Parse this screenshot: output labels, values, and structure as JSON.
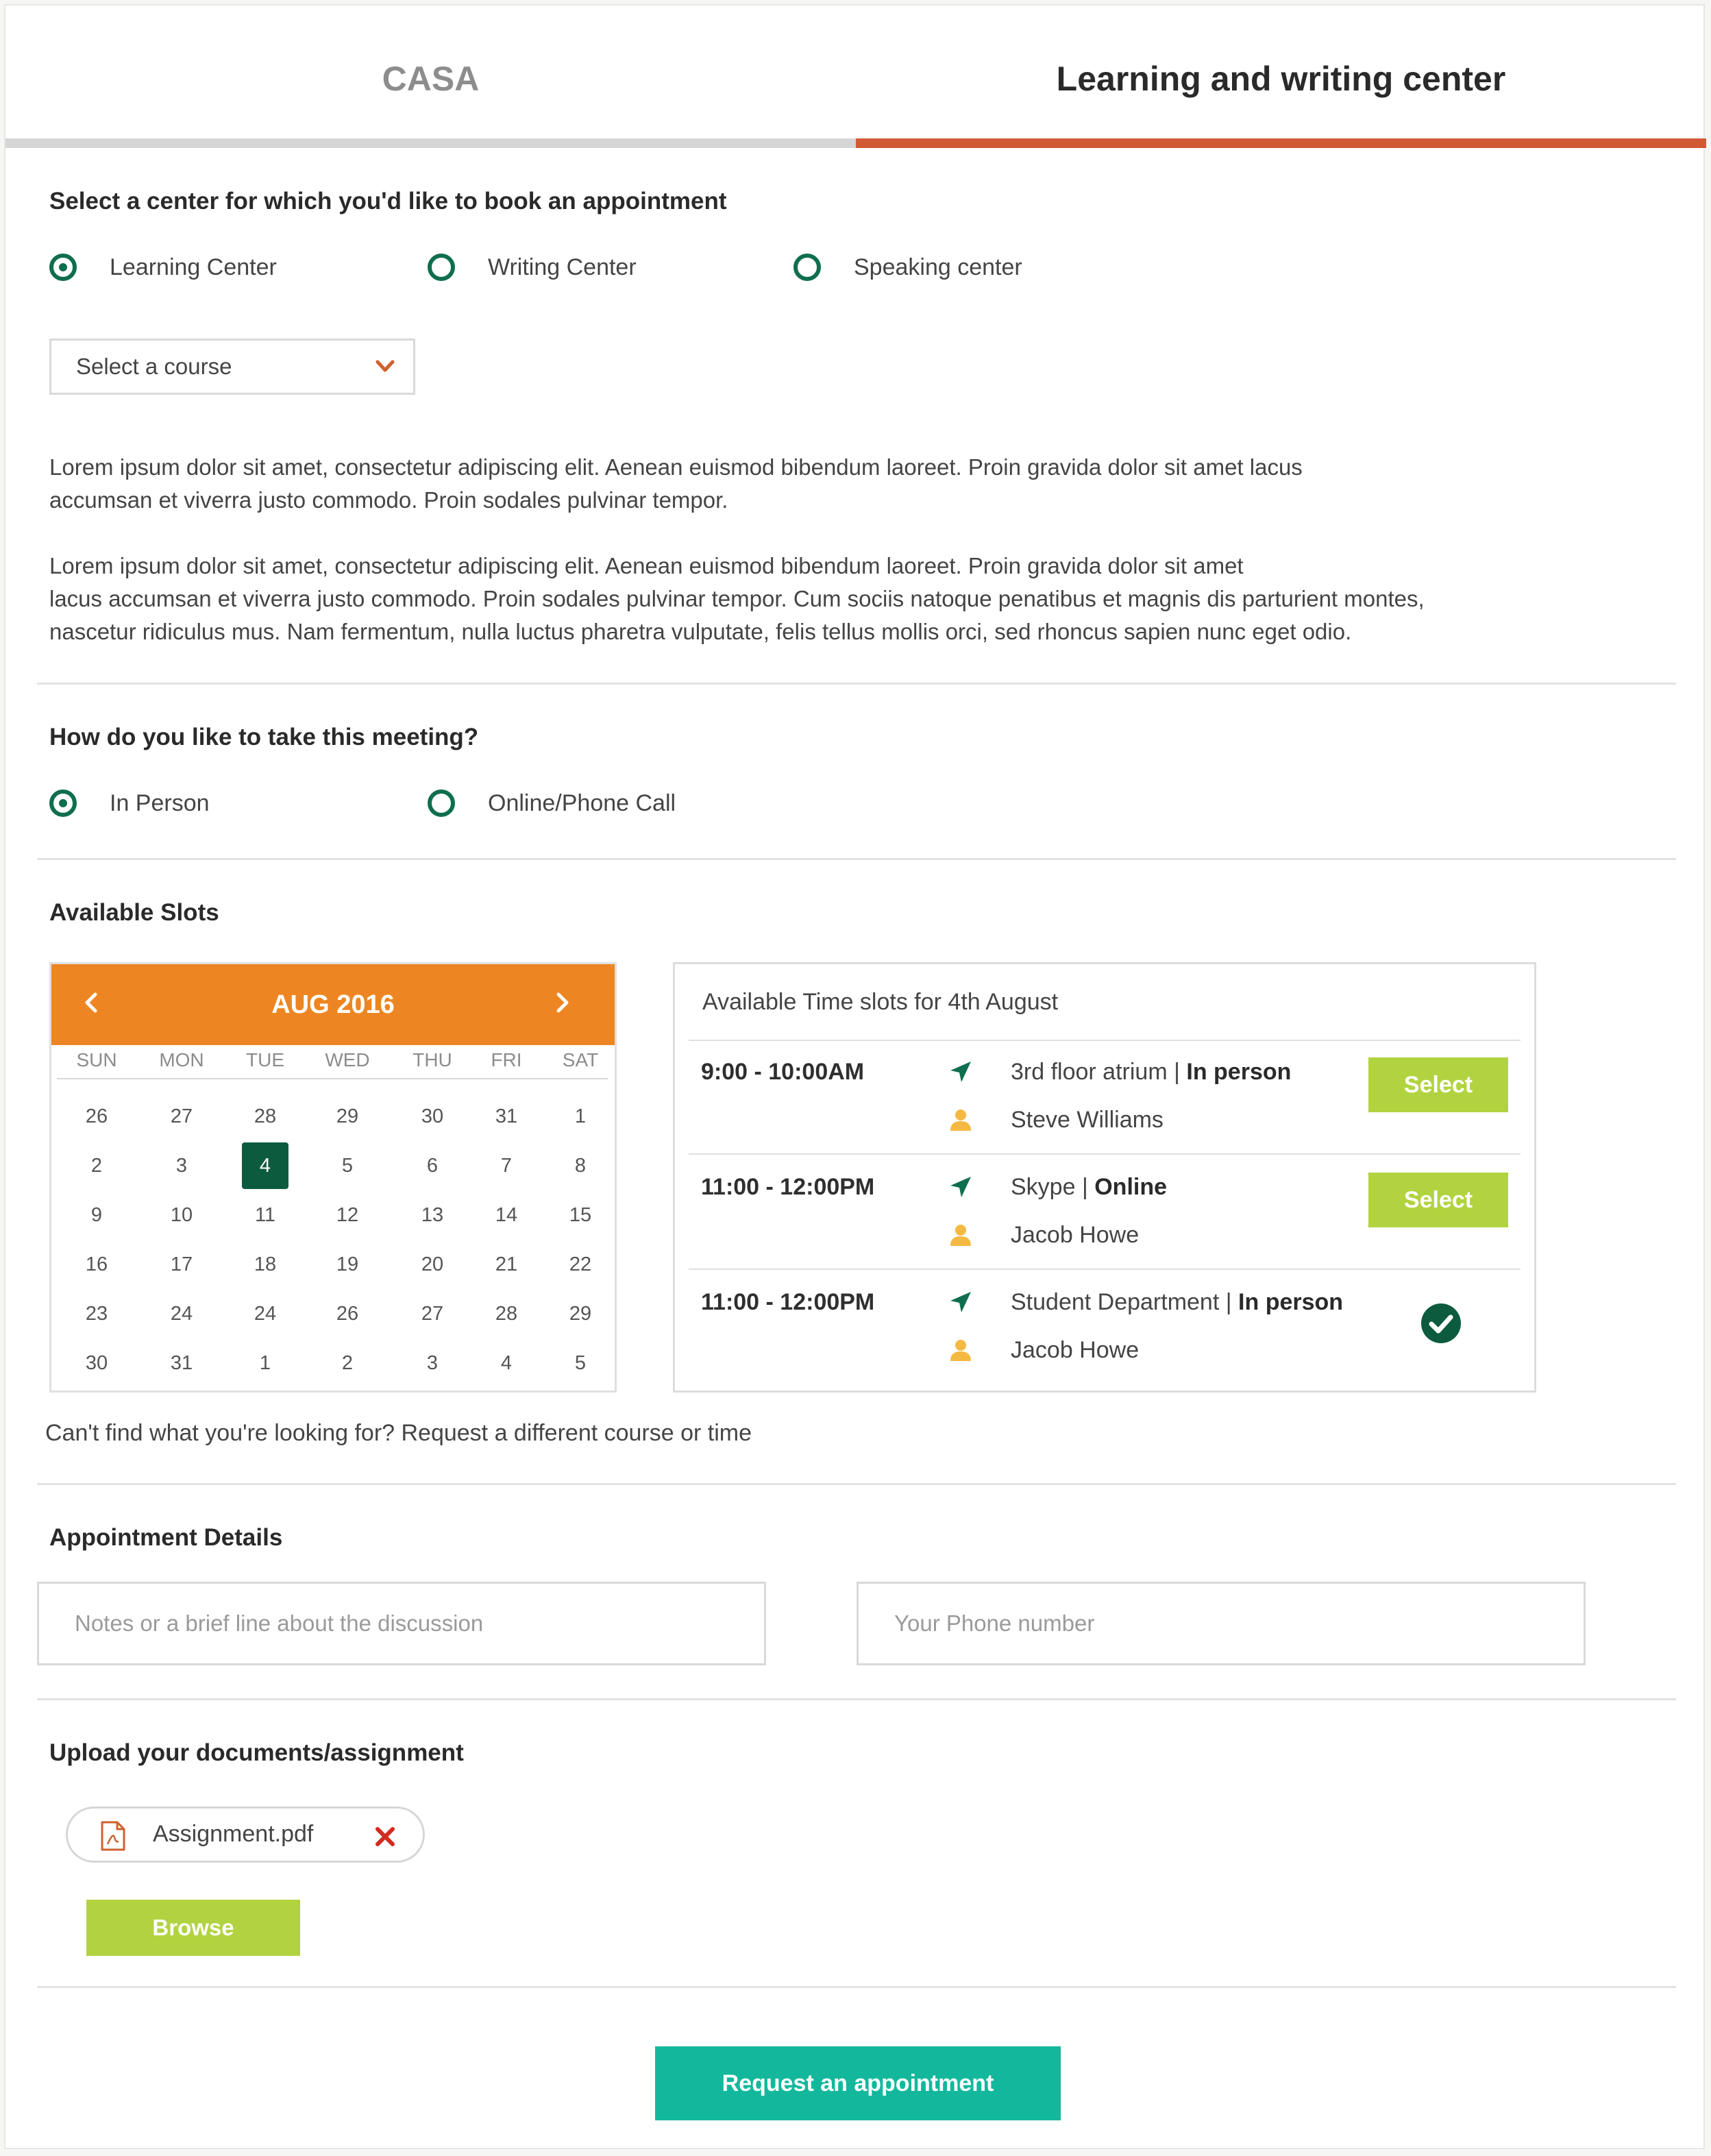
{
  "tabs": [
    {
      "label": "CASA",
      "active": false
    },
    {
      "label": "Learning and writing center",
      "active": true
    }
  ],
  "center_section": {
    "title": "Select a center for which you'd like to book an appointment",
    "options": [
      {
        "label": "Learning Center",
        "checked": true
      },
      {
        "label": "Writing Center",
        "checked": false
      },
      {
        "label": "Speaking center",
        "checked": false
      }
    ],
    "course_select": {
      "value": "Select a course",
      "icon": "chevron-down-icon"
    }
  },
  "description": {
    "p1": "Lorem ipsum dolor sit amet, consectetur adipiscing elit. Aenean euismod bibendum laoreet. Proin gravida dolor sit amet lacus accumsan et viverra justo commodo. Proin sodales pulvinar tempor.",
    "p2_l1": "Lorem ipsum dolor sit amet, consectetur adipiscing elit. Aenean euismod bibendum laoreet. Proin gravida dolor sit amet",
    "p2_l2": "lacus accumsan et viverra justo commodo. Proin sodales pulvinar tempor. Cum sociis natoque penatibus et magnis dis parturient montes,",
    "p2_l3": "nascetur ridiculus mus. Nam fermentum, nulla luctus pharetra vulputate, felis tellus mollis orci, sed rhoncus sapien nunc eget odio."
  },
  "meeting_section": {
    "title": "How do you like to take this meeting?",
    "options": [
      {
        "label": "In Person",
        "checked": true
      },
      {
        "label": "Online/Phone Call",
        "checked": false
      }
    ]
  },
  "slots_section": {
    "title": "Available Slots",
    "calendar": {
      "month_label": "AUG 2016",
      "weekdays": [
        "SUN",
        "MON",
        "TUE",
        "WED",
        "THU",
        "FRI",
        "SAT"
      ],
      "weeks": [
        [
          "26",
          "27",
          "28",
          "29",
          "30",
          "31",
          "1"
        ],
        [
          "2",
          "3",
          "4",
          "5",
          "6",
          "7",
          "8"
        ],
        [
          "9",
          "10",
          "11",
          "12",
          "13",
          "14",
          "15"
        ],
        [
          "16",
          "17",
          "18",
          "19",
          "20",
          "21",
          "22"
        ],
        [
          "23",
          "24",
          "24",
          "26",
          "27",
          "28",
          "29"
        ],
        [
          "30",
          "31",
          "1",
          "2",
          "3",
          "4",
          "5"
        ]
      ],
      "selected_day": "4"
    },
    "time_slots": {
      "title": "Available Time slots for 4th August",
      "items": [
        {
          "time": "9:00 - 10:00AM",
          "location": "3rd floor atrium",
          "separator": " | ",
          "mode": "In person",
          "person": "Steve Williams",
          "action": "Select"
        },
        {
          "time": "11:00 - 12:00PM",
          "location": "Skype",
          "separator": " | ",
          "mode": "Online",
          "person": "Jacob Howe",
          "action": "Select"
        },
        {
          "time": "11:00 - 12:00PM",
          "location": "Student Department",
          "separator": " | ",
          "mode": "In person",
          "person": "Jacob Howe",
          "action": "selected"
        }
      ]
    },
    "help_text": "Can't find what you're looking for? Request a different course or time"
  },
  "appointment_details": {
    "title": "Appointment Details",
    "notes_placeholder": "Notes or a brief line about the discussion",
    "phone_placeholder": "Your Phone number"
  },
  "upload": {
    "title": "Upload your documents/assignment",
    "file_name": "Assignment.pdf",
    "browse_label": "Browse"
  },
  "submit_label": "Request an appointment",
  "colors": {
    "accent_orange": "#ed8622",
    "tab_active": "#cf5a33",
    "radio_green": "#0f6e4f",
    "button_lime": "#b1d340",
    "button_teal": "#13b89c",
    "selected_day": "#0d5b3e",
    "person_icon": "#f4b942"
  }
}
